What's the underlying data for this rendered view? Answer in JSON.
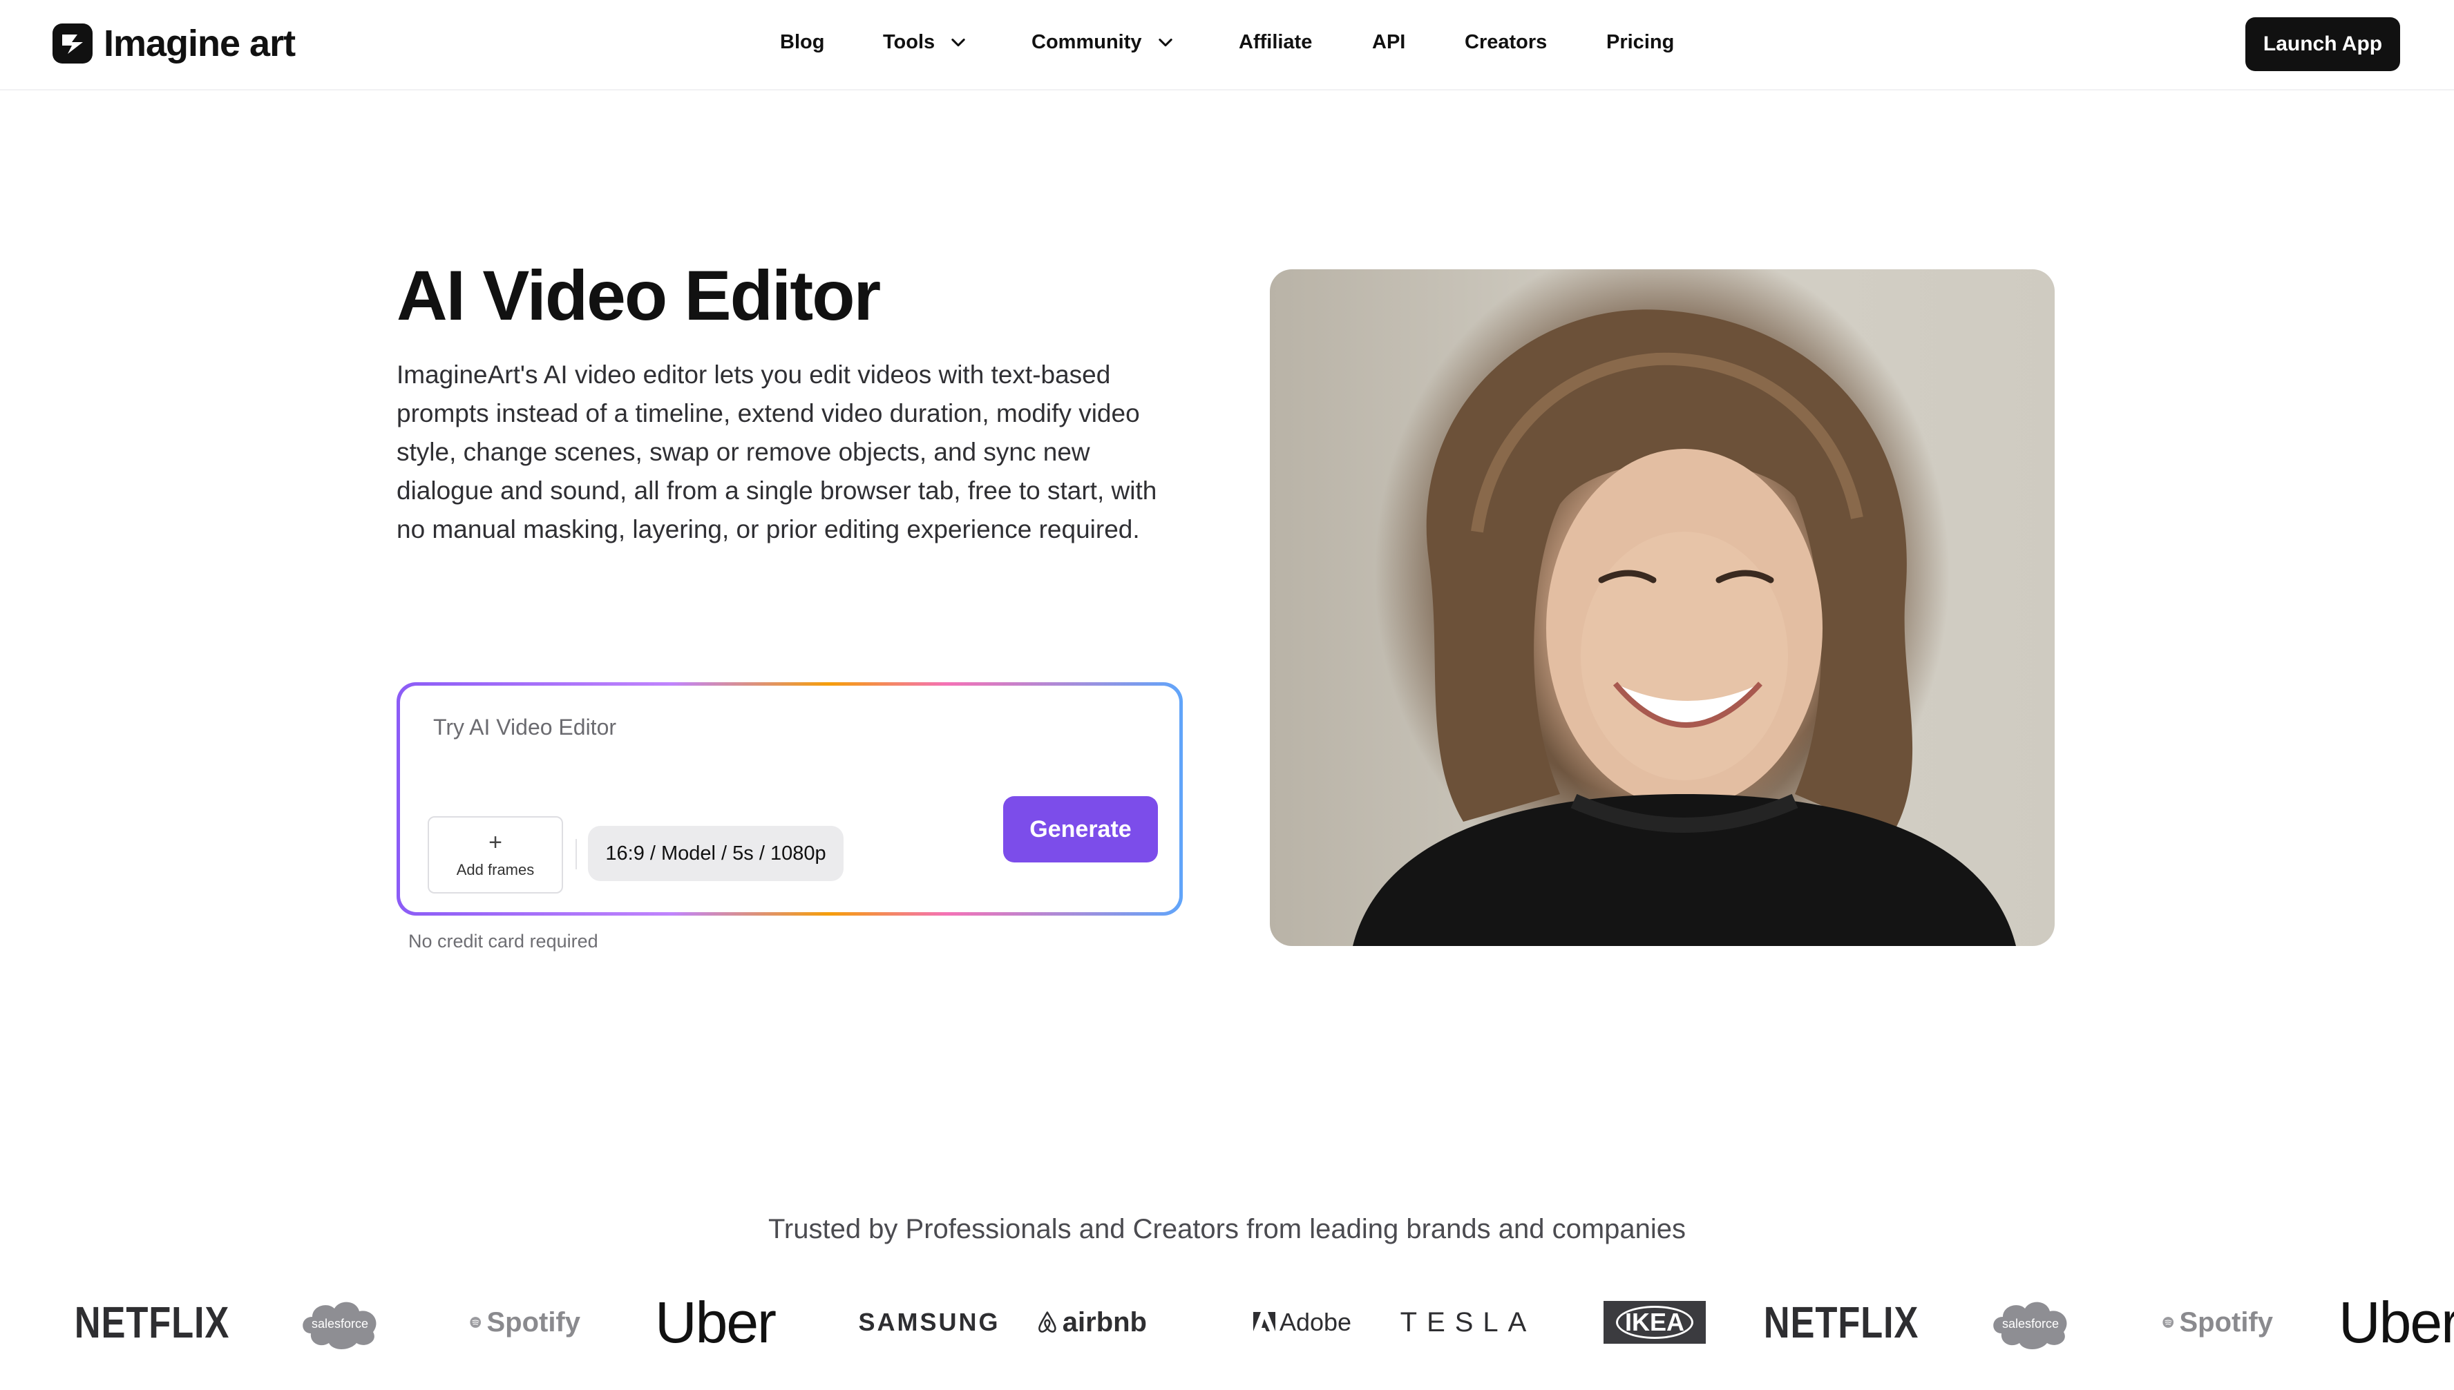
{
  "header": {
    "brand": "Imagine art",
    "nav": [
      {
        "label": "Blog",
        "has_dropdown": false
      },
      {
        "label": "Tools",
        "has_dropdown": true
      },
      {
        "label": "Community",
        "has_dropdown": true
      },
      {
        "label": "Affiliate",
        "has_dropdown": false
      },
      {
        "label": "API",
        "has_dropdown": false
      },
      {
        "label": "Creators",
        "has_dropdown": false
      },
      {
        "label": "Pricing",
        "has_dropdown": false
      }
    ],
    "launch_label": "Launch App"
  },
  "hero": {
    "title": "AI Video Editor",
    "description": "ImagineArt's AI video editor lets you edit videos with text-based prompts instead of a timeline, extend video duration, modify video style, change scenes, swap or remove objects, and sync new dialogue and sound, all from a single browser tab, free to start, with no manual masking, layering, or prior editing experience required.",
    "prompt": {
      "placeholder": "Try AI Video Editor",
      "add_frames_label": "Add frames",
      "settings_label": "16:9 / Model / 5s / 1080p",
      "generate_label": "Generate"
    },
    "note": "No credit card required"
  },
  "trusted": {
    "heading": "Trusted by Professionals and Creators from leading brands and companies",
    "brands": [
      "NETFLIX",
      "salesforce",
      "Spotify",
      "Uber",
      "SAMSUNG",
      "airbnb",
      "Adobe",
      "TESLA",
      "IKEA",
      "NETFLIX",
      "salesforce",
      "Spotify",
      "Uber"
    ]
  },
  "colors": {
    "accent": "#7c4dea",
    "dark": "#111111",
    "text_muted": "#6e6e73"
  },
  "icons": {
    "logo": "imagine-art-logo-icon",
    "dropdown": "chevron-down-icon",
    "add": "plus-icon",
    "spotify": "spotify-icon",
    "airbnb": "airbnb-icon",
    "adobe": "adobe-icon"
  }
}
